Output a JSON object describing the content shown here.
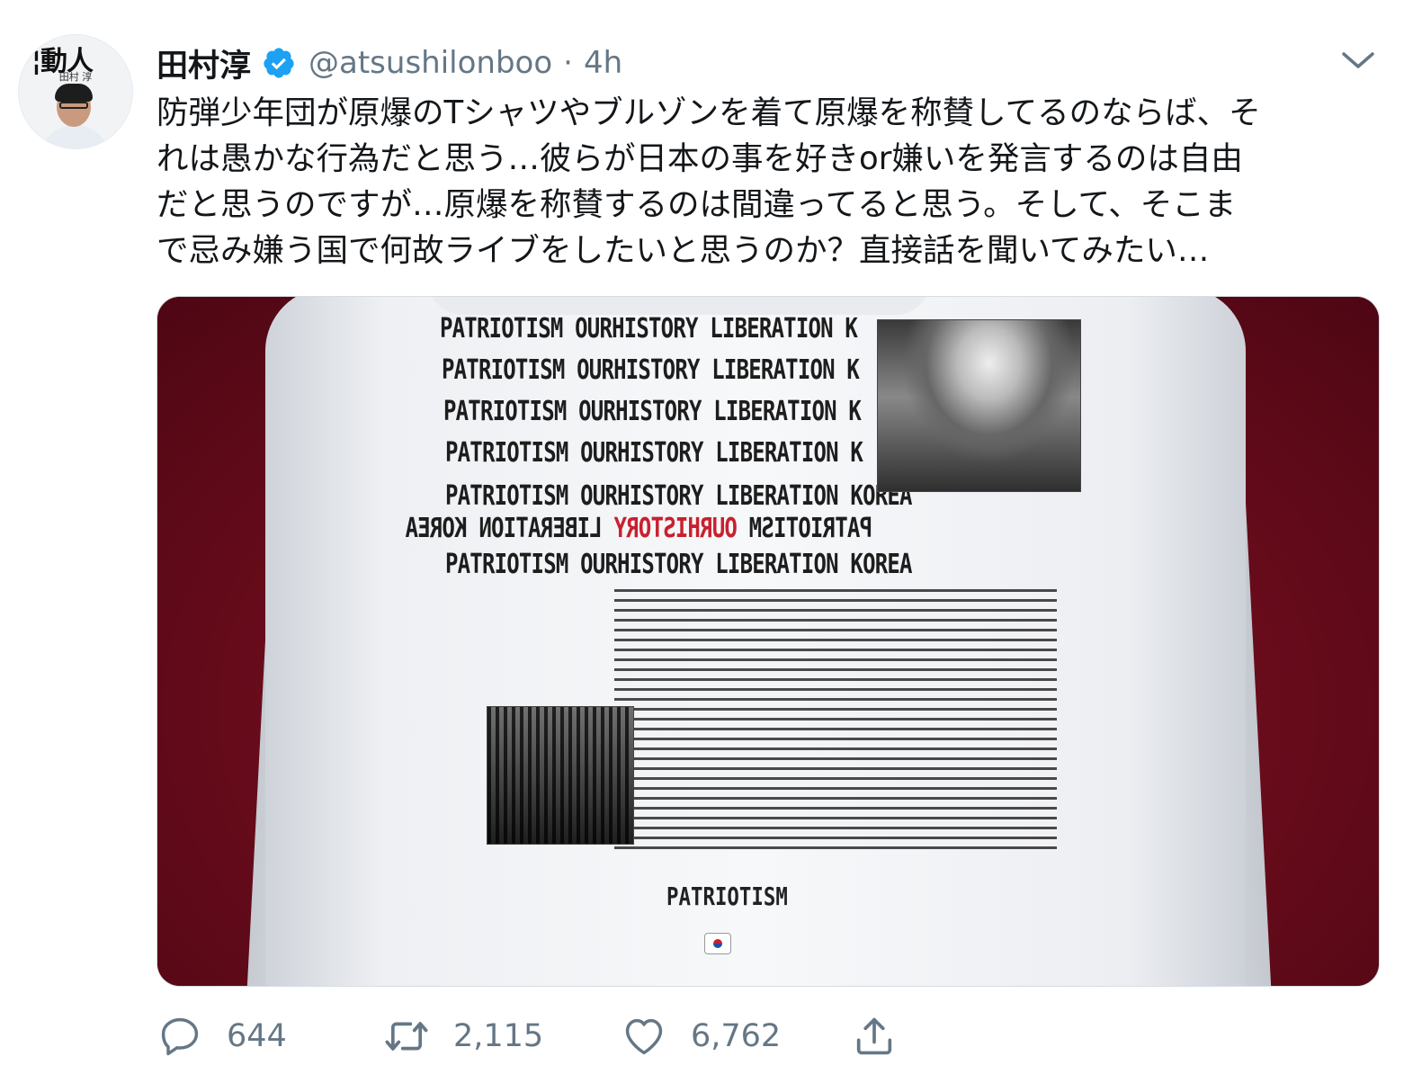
{
  "tweet": {
    "avatar_text_top": "¦動人",
    "avatar_text_name": "田村 淳",
    "display_name": "田村淳",
    "handle": "@atsushilonboo",
    "separator": "·",
    "time": "4h",
    "text": "防弾少年団が原爆のTシャツやブルゾンを着て原爆を称賛してるのならば、そ\nれは愚かな行為だと思う…彼らが日本の事を好きor嫌いを発言するのは自由\nだと思うのですが…原爆を称賛するのは間違ってると思う。そして、そこま\nで忌み嫌う国で何故ライブをしたいと思うのか？直接話を聞いてみたい…"
  },
  "media": {
    "print_lines": [
      "PATRIOTISM OURHISTORY LIBERATION K",
      "PATRIOTISM OURHISTORY LIBERATION K",
      "PATRIOTISM OURHISTORY LIBERATION K",
      "PATRIOTISM OURHISTORY LIBERATION K",
      "PATRIOTISM OURHISTORY LIBERATION KOREA",
      "PATRIOTISM OURHISTORY LIBERATION KOREA"
    ],
    "mirror_left": "PATRIOTISM",
    "mirror_red": "OURHISTORY",
    "mirror_right": "LIBERATION KOREA",
    "bottom_label": "PATRIOTISM"
  },
  "actions": {
    "reply_count": "644",
    "retweet_count": "2,115",
    "like_count": "6,762"
  },
  "colors": {
    "text": "#14171a",
    "secondary": "#657786",
    "verified": "#1da1f2",
    "backdrop": "#6d0e1e"
  },
  "icons": {
    "verified": "verified-badge-icon",
    "caret": "chevron-down-icon",
    "reply": "reply-icon",
    "retweet": "retweet-icon",
    "like": "heart-icon",
    "share": "share-icon"
  }
}
